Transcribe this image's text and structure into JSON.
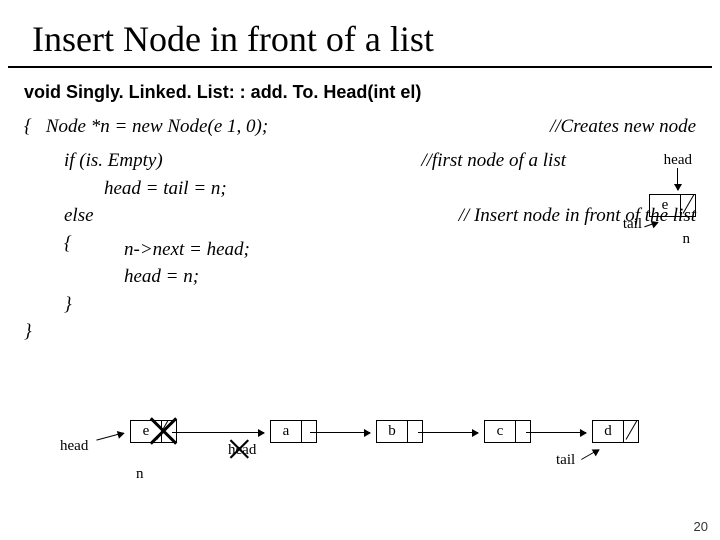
{
  "title": "Insert Node in front of a list",
  "signature": "void Singly. Linked. List: : add. To. Head(int el)",
  "code": {
    "open": "{   Node *n = new Node(e 1, 0);",
    "c1": "//Creates new node",
    "if": "if (is. Empty)",
    "c2": "//first node of a list",
    "assign1": "head = tail = n;",
    "else": "else",
    "brace_open": "{",
    "nxt": "n->next = head;",
    "assign2": "head = n;",
    "brace_close": "}",
    "close": "}"
  },
  "top_diag": {
    "head": "head",
    "tail": "tail",
    "n": "n",
    "e": "e"
  },
  "bottom_diag": {
    "head": "head",
    "n": "n",
    "tail": "tail",
    "e": "e",
    "a": "a",
    "b": "b",
    "c": "c",
    "d": "d",
    "old_head": "head"
  },
  "c3": "// Insert node in front of the list",
  "pagenum": "20"
}
